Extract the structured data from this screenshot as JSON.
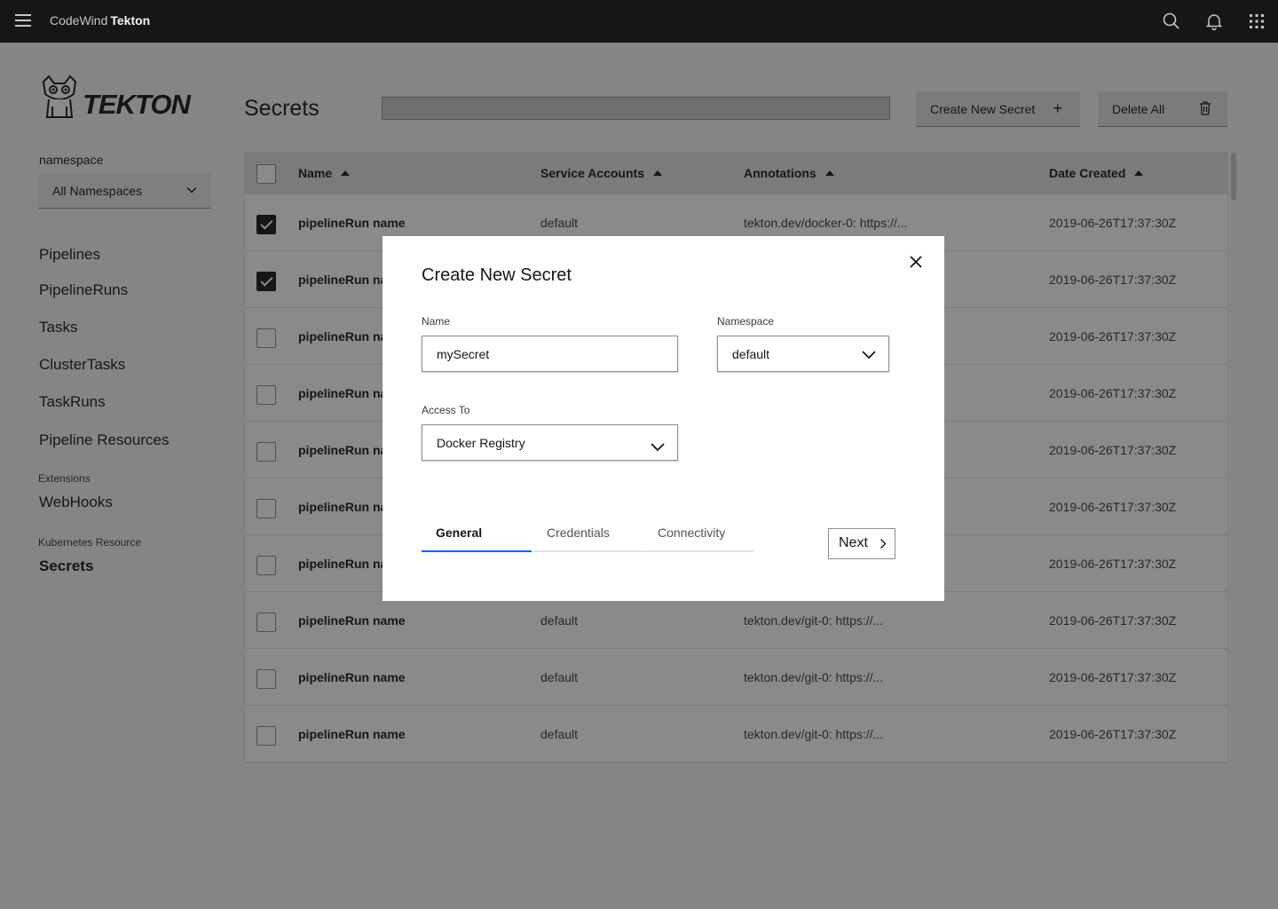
{
  "header": {
    "brand_prefix": "CodeWind",
    "brand_name": "Tekton",
    "icons": [
      "menu-icon",
      "search-icon",
      "notification-icon",
      "app-switcher-icon"
    ]
  },
  "logo": {
    "text": "TEKTON"
  },
  "sidebar": {
    "namespace_label": "namespace",
    "namespace_value": "All Namespaces",
    "items": [
      {
        "label": "Pipelines"
      },
      {
        "label": "PipelineRuns"
      },
      {
        "label": "Tasks"
      },
      {
        "label": "ClusterTasks"
      },
      {
        "label": "TaskRuns"
      },
      {
        "label": "Pipeline Resources"
      }
    ],
    "extensions_caption": "Extensions",
    "extensions_item": "WebHooks",
    "k8s_caption": "Kubernetes Resource",
    "k8s_item": "Secrets"
  },
  "page": {
    "title": "Secrets",
    "create_button": "Create New Secret",
    "delete_button": "Delete All"
  },
  "table": {
    "columns": [
      "Name",
      "Service Accounts",
      "Annotations",
      "Date Created"
    ],
    "rows": [
      {
        "checked": true,
        "name": "pipelineRun name",
        "account": "default",
        "annotation": "tekton.dev/docker-0: https://...",
        "date": "2019-06-26T17:37:30Z"
      },
      {
        "checked": true,
        "name": "pipelineRun na",
        "account": "",
        "annotation": "",
        "date": "2019-06-26T17:37:30Z"
      },
      {
        "checked": false,
        "name": "pipelineRun na",
        "account": "",
        "annotation": "",
        "date": "2019-06-26T17:37:30Z"
      },
      {
        "checked": false,
        "name": "pipelineRun na",
        "account": "",
        "annotation": "",
        "date": "2019-06-26T17:37:30Z"
      },
      {
        "checked": false,
        "name": "pipelineRun na",
        "account": "",
        "annotation": "",
        "date": "2019-06-26T17:37:30Z"
      },
      {
        "checked": false,
        "name": "pipelineRun na",
        "account": "",
        "annotation": "",
        "date": "2019-06-26T17:37:30Z"
      },
      {
        "checked": false,
        "name": "pipelineRun na",
        "account": "",
        "annotation": "",
        "date": "2019-06-26T17:37:30Z"
      },
      {
        "checked": false,
        "name": "pipelineRun name",
        "account": "default",
        "annotation": "tekton.dev/git-0: https://...",
        "date": "2019-06-26T17:37:30Z"
      },
      {
        "checked": false,
        "name": "pipelineRun name",
        "account": "default",
        "annotation": "tekton.dev/git-0: https://...",
        "date": "2019-06-26T17:37:30Z"
      },
      {
        "checked": false,
        "name": "pipelineRun name",
        "account": "default",
        "annotation": "tekton.dev/git-0: https://...",
        "date": "2019-06-26T17:37:30Z"
      }
    ]
  },
  "modal": {
    "title": "Create New Secret",
    "name_label": "Name",
    "name_value": "mySecret",
    "namespace_label": "Namespace",
    "namespace_value": "default",
    "access_label": "Access To",
    "access_value": "Docker Registry",
    "tabs": [
      {
        "label": "General",
        "active": true
      },
      {
        "label": "Credentials",
        "active": false
      },
      {
        "label": "Connectivity",
        "active": false
      }
    ],
    "next_button": "Next"
  },
  "colors": {
    "header_bg": "#161616",
    "overlay": "rgba(22,22,22,0.5)",
    "tab_active": "#0f62fe"
  }
}
